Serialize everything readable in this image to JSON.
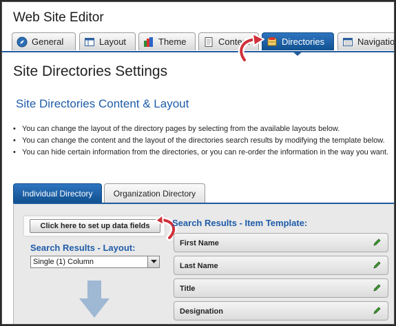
{
  "window": {
    "title": "Web Site Editor"
  },
  "tabs": [
    {
      "label": "General",
      "icon": "compass-icon"
    },
    {
      "label": "Layout",
      "icon": "layout-icon"
    },
    {
      "label": "Theme",
      "icon": "palette-icon"
    },
    {
      "label": "Content",
      "icon": "document-icon"
    },
    {
      "label": "Directories",
      "icon": "directory-icon",
      "active": true
    },
    {
      "label": "Navigation",
      "icon": "navigation-icon"
    }
  ],
  "page": {
    "title": "Site Directories Settings",
    "section_title": "Site Directories Content & Layout",
    "bullets": [
      "You can change the layout of the directory pages by selecting from the available layouts below.",
      "You can change the content and the layout of the directories search results by modifying the template below.",
      "You can hide certain information from the directories, or you can re-order the information in the way you want."
    ]
  },
  "panel": {
    "tabs": [
      {
        "label": "Individual Directory",
        "active": true
      },
      {
        "label": "Organization Directory"
      }
    ],
    "setup_button": "Click here to set up data fields",
    "layout_label": "Search Results - Layout:",
    "layout_value": "Single (1) Column",
    "item_template_title": "Search Results - Item Template:",
    "fields": [
      "First Name",
      "Last Name",
      "Title",
      "Designation"
    ]
  },
  "colors": {
    "accent": "#1f5a9c",
    "heading": "#1f5ca8",
    "callout": "#d0303a",
    "arrow": "#9fb8d3",
    "pencil": "#3c9a2e"
  }
}
